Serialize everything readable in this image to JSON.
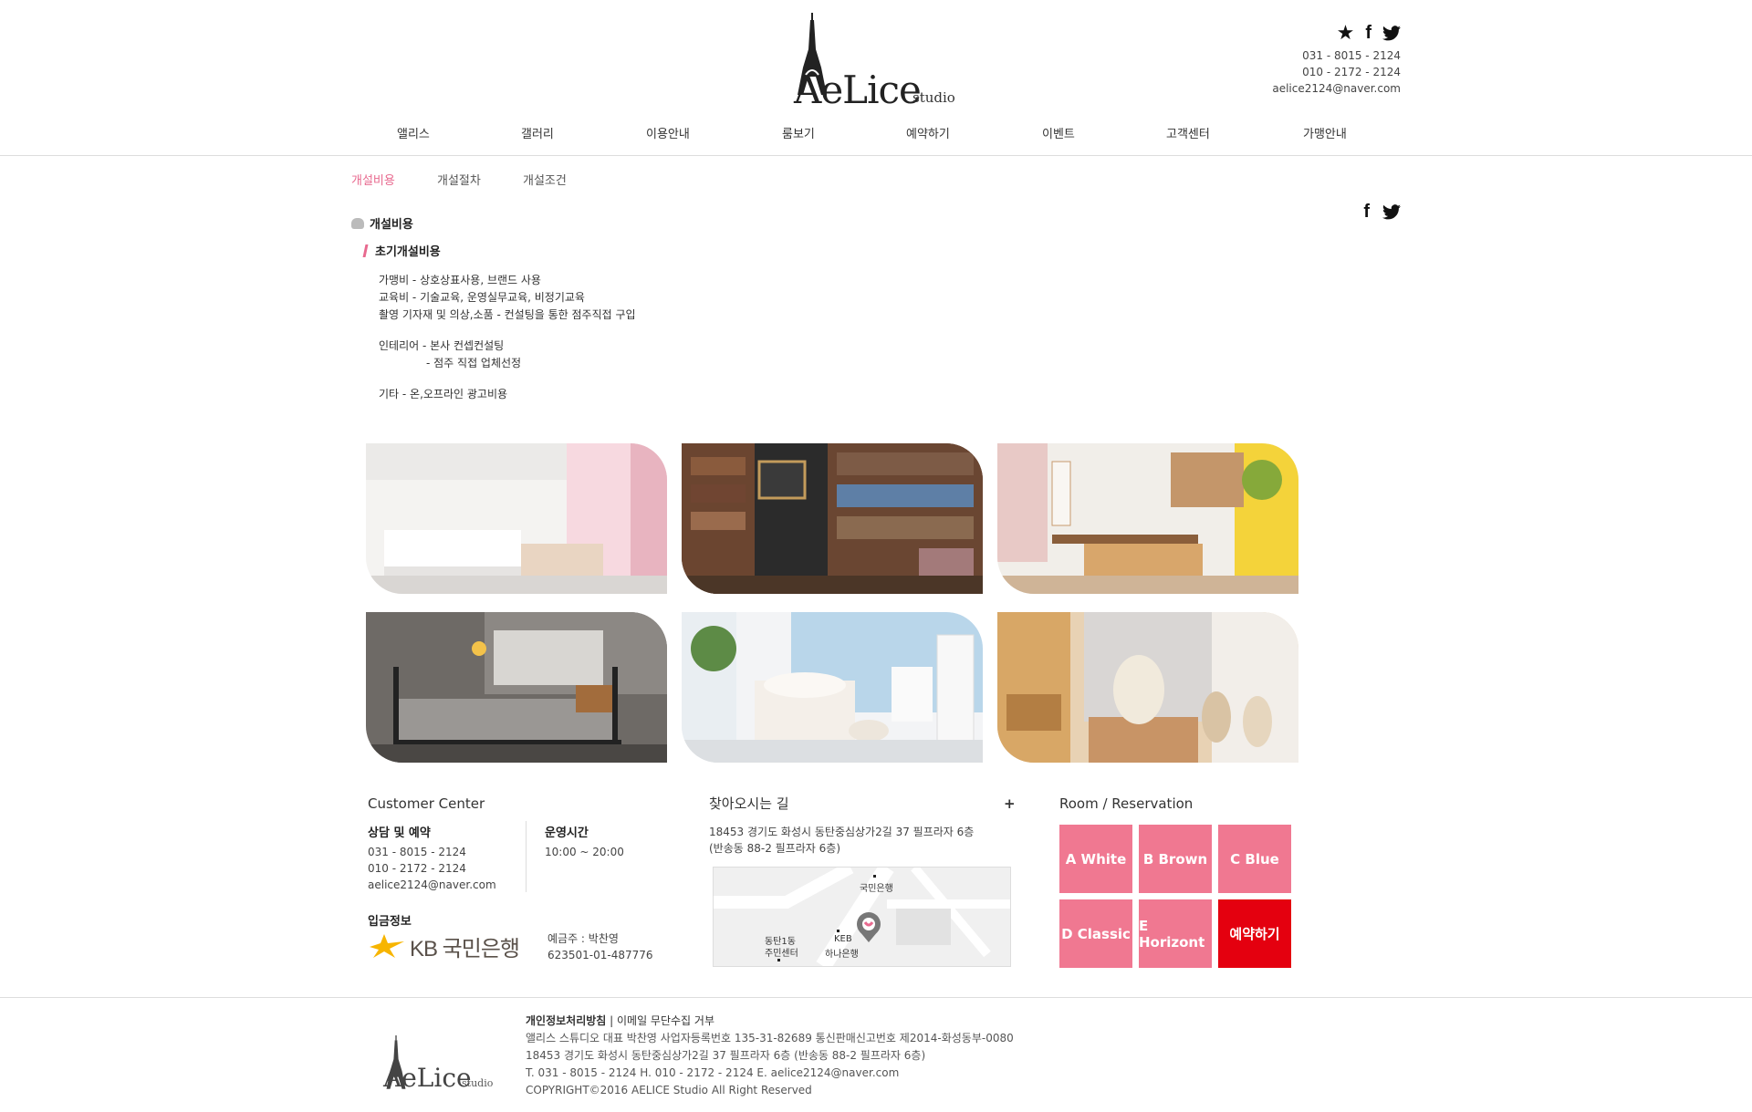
{
  "header": {
    "logo_text": "AeLice",
    "logo_sub": "studio",
    "phone1": "031 - 8015 - 2124",
    "phone2": "010 - 2172 - 2124",
    "email": "aelice2124@naver.com",
    "icons": [
      "star-icon",
      "facebook-icon",
      "twitter-icon"
    ]
  },
  "nav": {
    "items": [
      "앨리스",
      "갤러리",
      "이용안내",
      "룸보기",
      "예약하기",
      "이벤트",
      "고객센터",
      "가맹안내"
    ]
  },
  "subnav": {
    "items": [
      "개설비용",
      "개설절차",
      "개설조건"
    ],
    "active": "개설비용"
  },
  "content": {
    "title": "개설비용",
    "subtitle": "초기개설비용",
    "lines": [
      "가맹비 - 상호상표사용, 브랜드 사용",
      "교육비 - 기술교육, 운영실무교육, 비정기교육",
      "촬영 기자재 및 의상,소품 - 컨설팅을 통한 점주직접 구입",
      "인테리어 - 본사 컨셉컨설팅",
      "- 점주 직접 업체선정",
      "기타 - 온,오프라인 광고비용"
    ]
  },
  "customer_center": {
    "title": "Customer Center",
    "consult_head": "상담 및 예약",
    "phone1": "031 - 8015 - 2124",
    "phone2": "010 - 2172 - 2124",
    "email": "aelice2124@naver.com",
    "hours_head": "운영시간",
    "hours": "10:00 ~ 20:00",
    "deposit_head": "입금정보",
    "bank_name": "KB 국민은행",
    "holder": "예금주 : 박찬영",
    "account": "623501-01-487776"
  },
  "location": {
    "title": "찾아오시는 길",
    "plus": "+",
    "address1": "18453 경기도 화성시 동탄중심상가2길 37 필프라자 6층",
    "address2": "(반송동 88-2 필프라자 6층)",
    "map_labels": [
      "국민은행",
      "동탄1동",
      "주민센터",
      "KEB",
      "하나은행"
    ]
  },
  "rooms": {
    "title": "Room / Reservation",
    "buttons": [
      "A White",
      "B Brown",
      "C Blue",
      "D Classic",
      "E Horizont",
      "예약하기"
    ]
  },
  "footer": {
    "links": "개인정보처리방침",
    "links2": " | 이메일 무단수집 거부",
    "line1": "앨리스 스튜디오   대표 박찬영   사업자등록번호 135-31-82689   통신판매신고번호 제2014-화성동부-0080",
    "line2": "18453 경기도 화성시 동탄중심상가2길 37 필프라자 6층 (반송동 88-2 필프라자 6층)",
    "line3": "T. 031 - 8015 - 2124   H. 010 - 2172 - 2124   E. aelice2124@naver.com",
    "line4": "COPYRIGHT©2016 AELICE Studio All Right Reserved",
    "logo_text": "AeLice",
    "logo_sub": "studio"
  },
  "colors": {
    "accent_pink": "#f07891",
    "reserve_red": "#e4000f",
    "active_sub": "#e86a8f"
  }
}
